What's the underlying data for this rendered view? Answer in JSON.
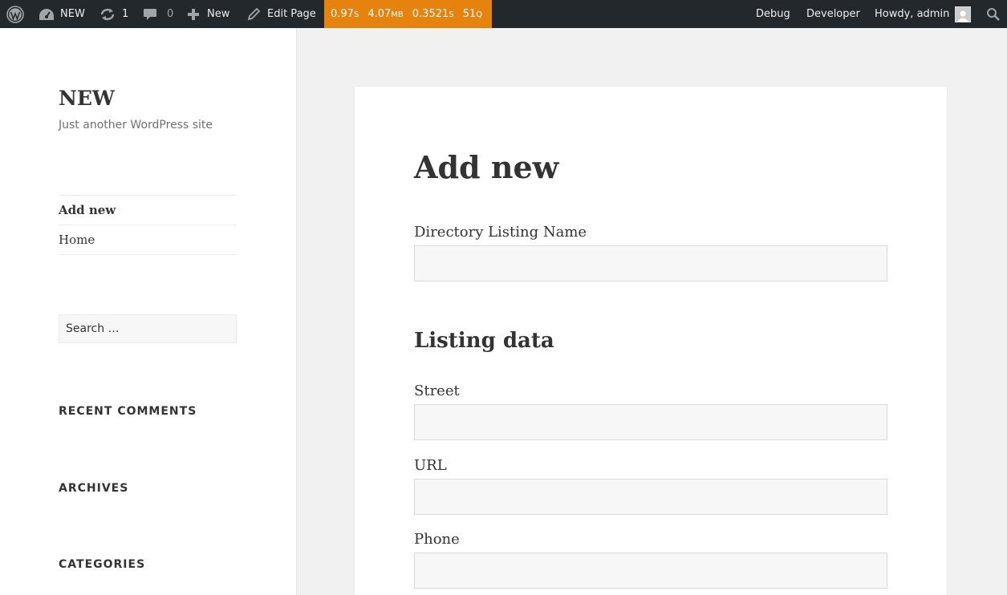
{
  "adminbar": {
    "site_name": "NEW",
    "updates_count": "1",
    "comments_count": "0",
    "new_label": "New",
    "edit_label": "Edit Page",
    "qm": {
      "time": "0.97",
      "time_unit": "S",
      "memory": "4.07",
      "memory_unit": "MB",
      "query_time": "0.3521",
      "query_time_unit": "S",
      "queries": "51",
      "queries_unit": "Q"
    },
    "debug_label": "Debug",
    "developer_label": "Developer",
    "howdy_label": "Howdy, admin",
    "qm_color": "#e6820e",
    "bar_color": "#23282d"
  },
  "sidebar": {
    "site_title": "NEW",
    "site_description": "Just another WordPress site",
    "nav": [
      {
        "label": "Add new"
      },
      {
        "label": "Home"
      }
    ],
    "search_placeholder": "Search …",
    "widgets": {
      "recent_comments": "RECENT COMMENTS",
      "archives": "ARCHIVES",
      "categories": "CATEGORIES"
    }
  },
  "main": {
    "title": "Add new",
    "fields": [
      {
        "label": "Directory Listing Name",
        "value": ""
      },
      {
        "label": "Street",
        "value": ""
      },
      {
        "label": "URL",
        "value": ""
      },
      {
        "label": "Phone",
        "value": ""
      }
    ],
    "section_title": "Listing data"
  }
}
